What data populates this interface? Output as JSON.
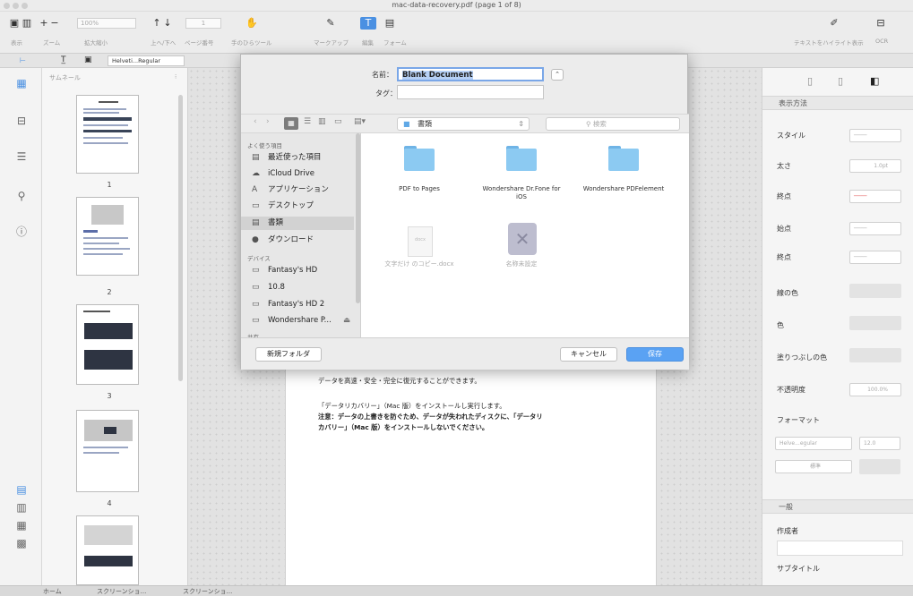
{
  "window": {
    "title": "mac-data-recovery.pdf (page 1 of 8)"
  },
  "toolbar": {
    "zoom_value": "100%",
    "page_value": "1",
    "labels": {
      "display": "表示",
      "zoom": "ズーム",
      "zoom_in_out": "拡大縮小",
      "prev_next": "上へ/下へ",
      "page_number": "ページ番号",
      "hand_tool": "手のひらツール",
      "markup": "マークアップ",
      "edit": "編集",
      "form": "フォーム",
      "text_highlight": "テキストをハイライト表示",
      "ocr": "OCR"
    }
  },
  "format_bar": {
    "font": "Helveti...Regular"
  },
  "thumbnails": {
    "header": "サムネール",
    "pages": [
      "1",
      "2",
      "3",
      "4"
    ]
  },
  "dialog": {
    "name_label": "名前：",
    "name_value": "Blank Document",
    "tags_label": "タグ：",
    "location": "書類",
    "search_placeholder": "検索",
    "favorites_header": "よく使う項目",
    "favorites": [
      {
        "icon": "clock-icon",
        "label": "最近使った項目"
      },
      {
        "icon": "cloud-icon",
        "label": "iCloud Drive"
      },
      {
        "icon": "apps-icon",
        "label": "アプリケーション"
      },
      {
        "icon": "desktop-icon",
        "label": "デスクトップ"
      },
      {
        "icon": "documents-icon",
        "label": "書類"
      },
      {
        "icon": "download-icon",
        "label": "ダウンロード"
      }
    ],
    "devices_header": "デバイス",
    "devices": [
      {
        "icon": "disk-icon",
        "label": "Fantasy's HD"
      },
      {
        "icon": "disk-icon",
        "label": "10.8"
      },
      {
        "icon": "disk-icon",
        "label": "Fantasy's HD 2"
      },
      {
        "icon": "disk-icon",
        "label": "Wondershare P..."
      }
    ],
    "shared_header": "共有",
    "files": [
      {
        "type": "folder",
        "label": "PDF to Pages"
      },
      {
        "type": "folder",
        "label": "Wondershare Dr.Fone for iOS"
      },
      {
        "type": "folder",
        "label": "Wondershare PDFelement"
      },
      {
        "type": "docx",
        "label": "文字だけ のコピー.docx"
      },
      {
        "type": "app",
        "label": "名称未設定"
      }
    ],
    "new_folder_button": "新規フォルダ",
    "cancel_button": "キャンセル",
    "save_button": "保存"
  },
  "document": {
    "lines": [
      "データを高速・安全・完全に復元することができます。",
      "「データリカバリー」（Mac 版）をインストールし実行します。",
      "注意：データの上書きを防ぐため、データが失われたディスクに、「データリ",
      "カバリー」（Mac 版）をインストールしないでください。"
    ]
  },
  "properties": {
    "section_display": "表示方法",
    "style_label": "スタイル",
    "thickness_label": "太さ",
    "thickness_value": "1.0pt",
    "start_label": "終点",
    "start2_label": "始点",
    "end_label": "終点",
    "line_color_label": "線の色",
    "color_label": "色",
    "fill_color_label": "塗りつぶしの色",
    "opacity_label": "不透明度",
    "opacity_value": "100.0%",
    "format_label": "フォーマット",
    "font_value": "Helve...egular",
    "size_value": "12.0",
    "align_value": "標準",
    "section_general": "一般",
    "author_label": "作成者",
    "subtitle_label": "サブタイトル"
  },
  "bottom_tabs": [
    "ホーム",
    "スクリーンショ...",
    "スクリーンショ..."
  ]
}
